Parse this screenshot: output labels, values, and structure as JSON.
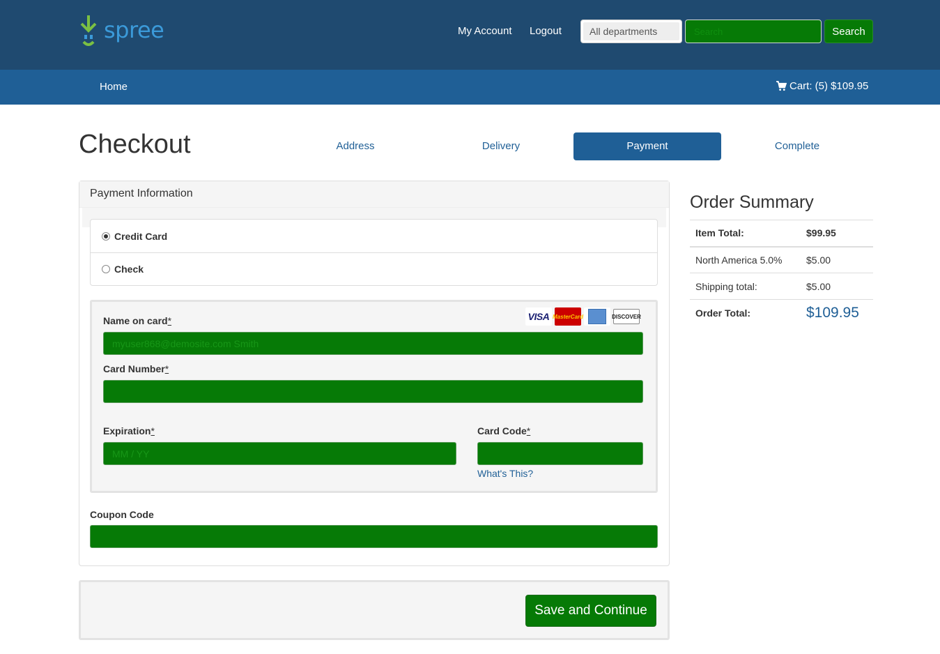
{
  "header": {
    "brand": "spree",
    "nav": {
      "account": "My Account",
      "logout": "Logout"
    },
    "department_select": "All departments",
    "search_placeholder": "Search",
    "search_button": "Search"
  },
  "mainnav": {
    "home": "Home",
    "cart": "Cart: (5) $109.95"
  },
  "checkout": {
    "title": "Checkout",
    "steps": [
      {
        "label": "Address",
        "active": false
      },
      {
        "label": "Delivery",
        "active": false
      },
      {
        "label": "Payment",
        "active": true
      },
      {
        "label": "Complete",
        "active": false
      }
    ]
  },
  "payment": {
    "heading": "Payment Information",
    "methods": [
      {
        "label": "Credit Card",
        "selected": true
      },
      {
        "label": "Check",
        "selected": false
      }
    ],
    "card_brands": [
      "VISA",
      "MasterCard",
      "American Express",
      "DISCOVER"
    ],
    "name_label": "Name on card",
    "name_value": "myuser868@demosite.com Smith",
    "number_label": "Card Number",
    "number_value": "",
    "expiration_label": "Expiration",
    "expiration_placeholder": "MM / YY",
    "code_label": "Card Code",
    "code_value": "",
    "required_marker": "*",
    "whats_this": "What's This?",
    "coupon_label": "Coupon Code",
    "coupon_value": "",
    "save_button": "Save and Continue"
  },
  "summary": {
    "title": "Order Summary",
    "rows": [
      {
        "label": "Item Total:",
        "value": "$99.95"
      },
      {
        "label": "North America 5.0%",
        "value": "$5.00"
      },
      {
        "label": "Shipping total:",
        "value": "$5.00"
      },
      {
        "label": "Order Total:",
        "value": "$109.95"
      }
    ]
  },
  "colors": {
    "header_dark": "#1f4a70",
    "nav_blue": "#1f5f96",
    "input_green": "#067a06",
    "logo_green": "#7bc043",
    "logo_blue": "#3b9ad9"
  }
}
